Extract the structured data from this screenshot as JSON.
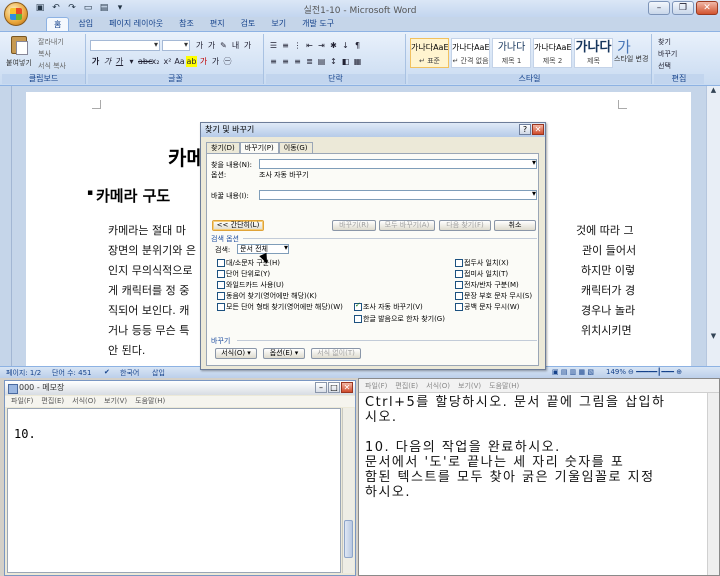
{
  "word": {
    "title": "실전1-10 - Microsoft Word",
    "tabs": [
      "홈",
      "삽입",
      "페이지 레이아웃",
      "참조",
      "편지",
      "검토",
      "보기",
      "개발 도구"
    ],
    "active_tab": "홈",
    "clipboard": {
      "paste": "붙여넣기",
      "cut": "잘라내기",
      "copy": "복사",
      "format_painter": "서식 복사",
      "label": "클립보드"
    },
    "groups": {
      "font": "글꼴",
      "paragraph": "단락",
      "styles": "스타일",
      "editing": "편집"
    },
    "styles": [
      {
        "preview": "가나다AaE",
        "name": "↵ 표준"
      },
      {
        "preview": "가나다AaE",
        "name": "↵ 간격 없음"
      },
      {
        "preview": "가나다",
        "name": "제목 1"
      },
      {
        "preview": "가나다AaE",
        "name": "제목 2"
      },
      {
        "preview": "가나다",
        "name": "제목"
      }
    ],
    "style_change": "스타일 변경",
    "editing_items": [
      "찾기",
      "바꾸기",
      "선택"
    ],
    "document": {
      "title": "카메",
      "heading": "카메라 구도",
      "lines": [
        "카메라는 절대 마",
        "장면의 분위기와 은",
        "인지 무의식적으로",
        "게 캐릭터를 정 중",
        "직되어 보인다. 캐",
        "거나 등등 무슨 특",
        "안 된다."
      ],
      "right_lines": [
        "것에 따라 그",
        "관이 들어서",
        "하지만 이렇",
        "캐릭터가 경",
        "경우나 놀라",
        "위치시키면"
      ]
    },
    "status": {
      "page": "페이지: 1/2",
      "words": "단어 수: 451",
      "language": "한국어",
      "mode": "삽입",
      "zoom": "149%"
    }
  },
  "dialog": {
    "title": "찾기 및 바꾸기",
    "help": "?",
    "tabs": [
      "찾기(D)",
      "바꾸기(P)",
      "이동(G)"
    ],
    "active_tab": "바꾸기(P)",
    "find_label": "찾을 내용(N):",
    "find_value": "",
    "options_label": "옵션:",
    "options_value": "조사 자동 바꾸기",
    "replace_label": "바꿀 내용(I):",
    "replace_value": "",
    "buttons": {
      "less": "<< 간단히(L)",
      "replace": "바꾸기(R)",
      "replace_all": "모두 바꾸기(A)",
      "find_next": "다음 찾기(F)",
      "cancel": "취소"
    },
    "search_options_title": "검색 옵션",
    "search_label": "검색:",
    "search_value": "문서 전체",
    "left_checks": [
      {
        "label": "대/소문자 구분(H)",
        "checked": false
      },
      {
        "label": "단어 단위로(Y)",
        "checked": false
      },
      {
        "label": "와일드카드 사용(U)",
        "checked": false
      },
      {
        "label": "동음어 찾기(영어에만 해당)(K)",
        "checked": false
      },
      {
        "label": "모든 단어 형태 찾기(영어에만 해당)(W)",
        "checked": false
      }
    ],
    "middle_check": {
      "label": "조사 자동 바꾸기(V)",
      "checked": true
    },
    "hanja_check": {
      "label": "한글 발음으로 한자 찾기(G)",
      "checked": false
    },
    "right_checks": [
      {
        "label": "접두사 일치(X)",
        "checked": false
      },
      {
        "label": "접미사 일치(T)",
        "checked": false
      },
      {
        "label": "전자/반자 구분(M)",
        "checked": false
      },
      {
        "label": "문장 부호 문자 무시(S)",
        "checked": false
      },
      {
        "label": "공백 문자 무시(W)",
        "checked": false
      }
    ],
    "replace_section_title": "바꾸기",
    "bottom_buttons": [
      "서식(O) ▾",
      "옵션(E) ▾",
      "서식 없이(T)"
    ]
  },
  "notepad": {
    "title": "000 - 메모장",
    "menu": [
      "파일(F)",
      "편집(E)",
      "서식(O)",
      "보기(V)",
      "도움말(H)"
    ],
    "content": "10."
  },
  "task": {
    "menu": [
      "파일(F)",
      "편집(E)",
      "서식(O)",
      "보기(V)",
      "도움말(H)"
    ],
    "lines": [
      "Ctrl+5를 할당하시오. 문서 끝에 그림을 삽입하",
      "시오.",
      "",
      "10. 다음의 작업을 완료하시오.",
      " 문서에서 '도'로 끝나는 세 자리 숫자를 포",
      "함된 텍스트를 모두 찾아 굵은 기울임꼴로 지정",
      "하시오."
    ]
  }
}
